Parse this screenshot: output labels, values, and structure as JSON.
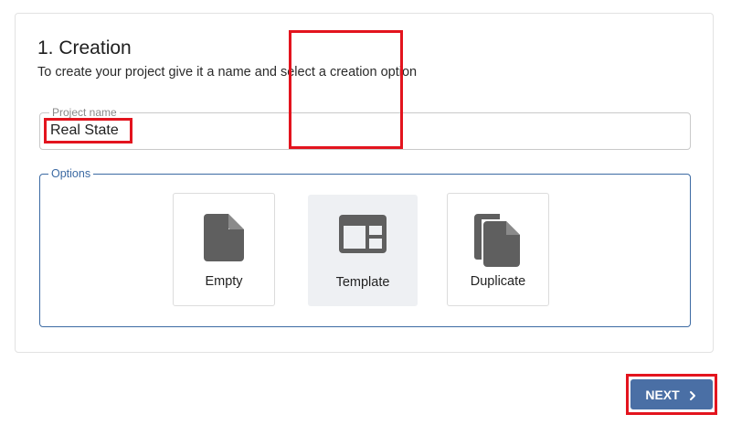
{
  "step": {
    "title": "1. Creation",
    "subtitle": "To create your project give it a name and select a creation option"
  },
  "project_name": {
    "legend": "Project name",
    "value": "Real State"
  },
  "options": {
    "legend": "Options",
    "items": [
      {
        "label": "Empty",
        "icon": "file-icon"
      },
      {
        "label": "Template",
        "icon": "template-icon",
        "selected": true
      },
      {
        "label": "Duplicate",
        "icon": "duplicate-icon"
      }
    ]
  },
  "actions": {
    "next_label": "NEXT",
    "next_icon": "chevron-right-icon"
  },
  "colors": {
    "accent": "#4a6fa5",
    "options_border": "#3c6aa3",
    "highlight": "#e3141e",
    "icon": "#5f5f5f"
  }
}
